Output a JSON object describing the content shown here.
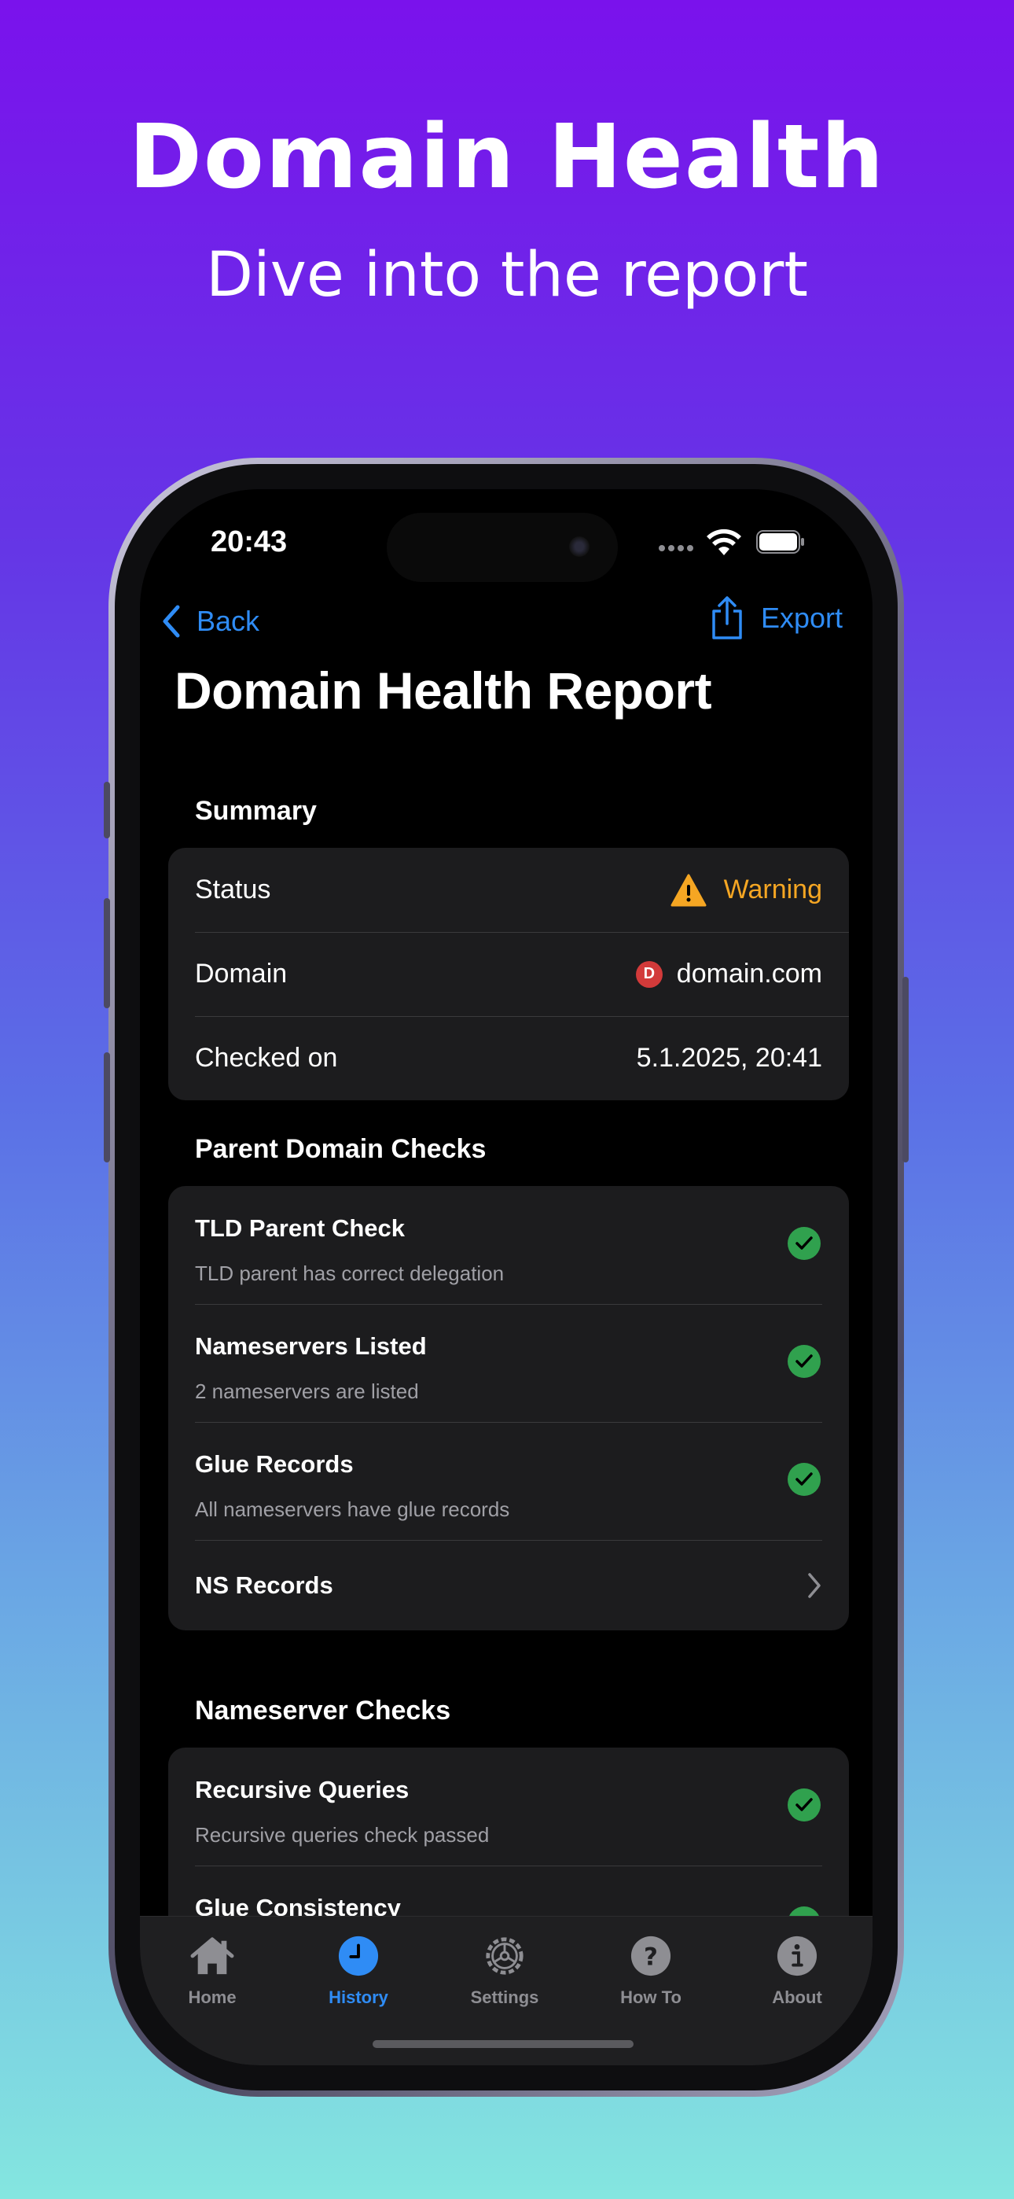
{
  "hero": {
    "title": "Domain Health",
    "subtitle": "Dive into the report"
  },
  "status_bar": {
    "time": "20:43"
  },
  "nav": {
    "back_label": "Back",
    "export_label": "Export"
  },
  "page": {
    "title": "Domain Health Report"
  },
  "summary": {
    "header": "Summary",
    "rows": [
      {
        "label": "Status",
        "value": "Warning"
      },
      {
        "label": "Domain",
        "value": "domain.com"
      },
      {
        "label": "Checked on",
        "value": "5.1.2025, 20:41"
      }
    ]
  },
  "parent_checks": {
    "header": "Parent Domain Checks",
    "items": [
      {
        "title": "TLD Parent Check",
        "subtitle": "TLD parent has correct delegation"
      },
      {
        "title": "Nameservers Listed",
        "subtitle": "2 nameservers are listed"
      },
      {
        "title": "Glue Records",
        "subtitle": "All nameservers have glue records"
      }
    ],
    "link": "NS Records"
  },
  "ns_checks": {
    "header": "Nameserver Checks",
    "items": [
      {
        "title": "Recursive Queries",
        "subtitle": "Recursive queries check passed"
      },
      {
        "title": "Glue Consistency",
        "subtitle": ""
      }
    ]
  },
  "tabs": [
    {
      "label": "Home",
      "icon": "house-icon"
    },
    {
      "label": "History",
      "icon": "clock-icon",
      "active": true
    },
    {
      "label": "Settings",
      "icon": "gear-icon"
    },
    {
      "label": "How To",
      "icon": "question-icon"
    },
    {
      "label": "About",
      "icon": "info-icon"
    }
  ],
  "colors": {
    "accent": "#2f8cf5",
    "warning": "#f5a623",
    "success": "#30a14e",
    "card": "#1c1c1e"
  }
}
